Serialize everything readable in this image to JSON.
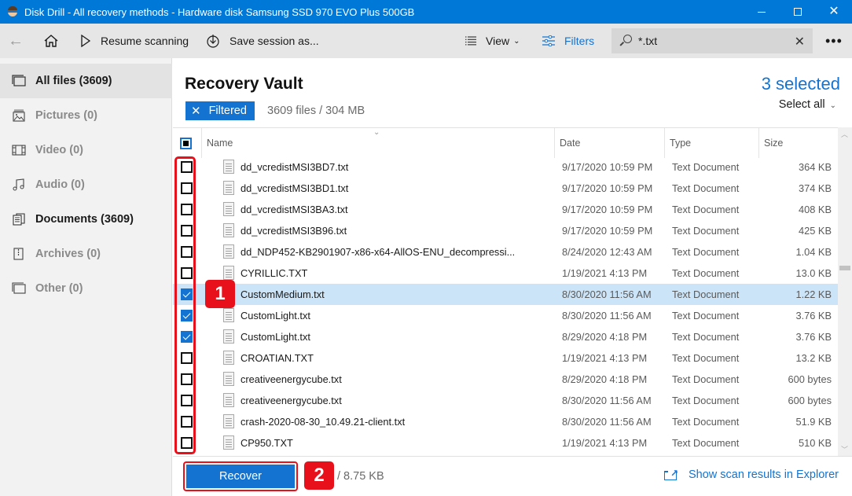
{
  "window": {
    "title": "Disk Drill - All recovery methods - Hardware disk Samsung SSD 970 EVO Plus 500GB",
    "controls": {
      "minimize": "—",
      "maximize": "☐",
      "close": "✕"
    }
  },
  "toolbar": {
    "back_icon": "←",
    "resume_label": "Resume scanning",
    "save_label": "Save session as...",
    "view_label": "View",
    "filters_label": "Filters",
    "search_value": "*.txt",
    "search_clear": "✕",
    "more_label": "•••"
  },
  "sidebar": {
    "items": [
      {
        "label": "All files (3609)",
        "icon": "all-files-icon",
        "state": "active"
      },
      {
        "label": "Pictures (0)",
        "icon": "pictures-icon",
        "state": "disabled"
      },
      {
        "label": "Video (0)",
        "icon": "video-icon",
        "state": "disabled"
      },
      {
        "label": "Audio (0)",
        "icon": "audio-icon",
        "state": "disabled"
      },
      {
        "label": "Documents (3609)",
        "icon": "documents-icon",
        "state": "enabled"
      },
      {
        "label": "Archives (0)",
        "icon": "archives-icon",
        "state": "disabled"
      },
      {
        "label": "Other (0)",
        "icon": "other-icon",
        "state": "disabled"
      }
    ]
  },
  "main": {
    "title": "Recovery Vault",
    "filter_badge": "Filtered",
    "filter_badge_x": "✕",
    "file_summary": "3609 files / 304 MB",
    "selected_count": "3 selected",
    "select_all_label": "Select all",
    "select_all_chevron": "⌄",
    "sort_chevron": "⌄",
    "columns": {
      "name": "Name",
      "date": "Date",
      "type": "Type",
      "size": "Size"
    },
    "rows": [
      {
        "name": "dd_vcredistMSI3BD7.txt",
        "date": "9/17/2020 10:59 PM",
        "type": "Text Document",
        "size": "364 KB",
        "checked": false,
        "highlighted": false
      },
      {
        "name": "dd_vcredistMSI3BD1.txt",
        "date": "9/17/2020 10:59 PM",
        "type": "Text Document",
        "size": "374 KB",
        "checked": false,
        "highlighted": false
      },
      {
        "name": "dd_vcredistMSI3BA3.txt",
        "date": "9/17/2020 10:59 PM",
        "type": "Text Document",
        "size": "408 KB",
        "checked": false,
        "highlighted": false
      },
      {
        "name": "dd_vcredistMSI3B96.txt",
        "date": "9/17/2020 10:59 PM",
        "type": "Text Document",
        "size": "425 KB",
        "checked": false,
        "highlighted": false
      },
      {
        "name": "dd_NDP452-KB2901907-x86-x64-AllOS-ENU_decompressi...",
        "date": "8/24/2020 12:43 AM",
        "type": "Text Document",
        "size": "1.04 KB",
        "checked": false,
        "highlighted": false
      },
      {
        "name": "CYRILLIC.TXT",
        "date": "1/19/2021 4:13 PM",
        "type": "Text Document",
        "size": "13.0 KB",
        "checked": false,
        "highlighted": false
      },
      {
        "name": "CustomMedium.txt",
        "date": "8/30/2020 11:56 AM",
        "type": "Text Document",
        "size": "1.22 KB",
        "checked": true,
        "highlighted": true
      },
      {
        "name": "CustomLight.txt",
        "date": "8/30/2020 11:56 AM",
        "type": "Text Document",
        "size": "3.76 KB",
        "checked": true,
        "highlighted": false
      },
      {
        "name": "CustomLight.txt",
        "date": "8/29/2020 4:18 PM",
        "type": "Text Document",
        "size": "3.76 KB",
        "checked": true,
        "highlighted": false
      },
      {
        "name": "CROATIAN.TXT",
        "date": "1/19/2021 4:13 PM",
        "type": "Text Document",
        "size": "13.2 KB",
        "checked": false,
        "highlighted": false
      },
      {
        "name": "creativeenergycube.txt",
        "date": "8/29/2020 4:18 PM",
        "type": "Text Document",
        "size": "600 bytes",
        "checked": false,
        "highlighted": false
      },
      {
        "name": "creativeenergycube.txt",
        "date": "8/30/2020 11:56 AM",
        "type": "Text Document",
        "size": "600 bytes",
        "checked": false,
        "highlighted": false
      },
      {
        "name": "crash-2020-08-30_10.49.21-client.txt",
        "date": "8/30/2020 11:56 AM",
        "type": "Text Document",
        "size": "51.9 KB",
        "checked": false,
        "highlighted": false
      },
      {
        "name": "CP950.TXT",
        "date": "1/19/2021 4:13 PM",
        "type": "Text Document",
        "size": "510 KB",
        "checked": false,
        "highlighted": false
      }
    ],
    "scroll_position": 0.45
  },
  "footer": {
    "recover_label": "Recover",
    "recover_size": "/ 8.75 KB",
    "explorer_link": "Show scan results in Explorer"
  },
  "annotations": {
    "badge_1": "1",
    "badge_2": "2",
    "color": "#e8101b"
  },
  "colors": {
    "accent": "#1473d0",
    "titlebar": "#0078d7",
    "selected_row": "#cce4f7"
  }
}
